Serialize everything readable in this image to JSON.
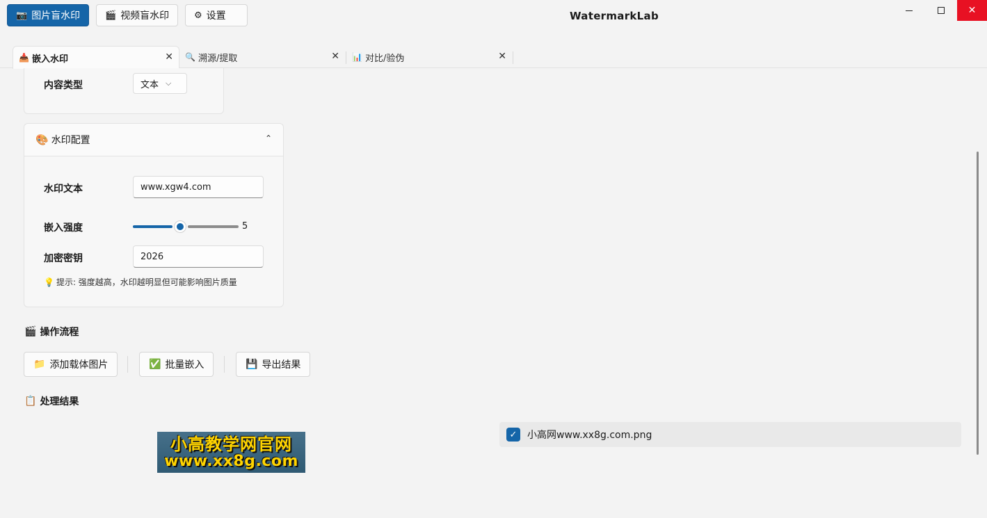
{
  "app": {
    "title": "WatermarkLab"
  },
  "toolbar": {
    "image_btn": {
      "icon": "📷",
      "label": "图片盲水印"
    },
    "video_btn": {
      "icon": "🎬",
      "label": "视频盲水印"
    },
    "settings_btn": {
      "icon": "⚙",
      "label": "设置"
    }
  },
  "window_controls": {
    "minimize_icon": "minimize-icon",
    "maximize_icon": "maximize-icon",
    "close": "✕"
  },
  "tabs": [
    {
      "icon": "📥",
      "label": "嵌入水印",
      "close": "✕"
    },
    {
      "icon": "🔍",
      "label": "溯源/提取",
      "close": "✕"
    },
    {
      "icon": "📊",
      "label": "对比/验伪",
      "close": "✕"
    }
  ],
  "content_type": {
    "label": "内容类型",
    "value": "文本",
    "chevron": "⌵"
  },
  "watermark_config": {
    "icon": "🎨",
    "title": "水印配置",
    "chevron": "⌃",
    "text_label": "水印文本",
    "text_value": "www.xgw4.com",
    "strength_label": "嵌入强度",
    "strength_value": "5",
    "strength_fraction": 0.45,
    "key_label": "加密密钥",
    "key_value": "2026",
    "hint_icon": "💡",
    "hint": "提示: 强度越高，水印越明显但可能影响图片质量"
  },
  "workflow": {
    "icon": "🎬",
    "title": "操作流程",
    "buttons": [
      {
        "icon": "📁",
        "label": "添加载体图片"
      },
      {
        "icon": "✅",
        "label": "批量嵌入"
      },
      {
        "icon": "💾",
        "label": "导出结果"
      }
    ]
  },
  "results": {
    "icon": "📋",
    "title": "处理结果",
    "preview_text_line1": "小高教学网官网",
    "preview_text_line2": "www.xx8g.com",
    "items": [
      {
        "checked": true,
        "check": "✓",
        "filename": "小高网www.xx8g.com.png"
      }
    ]
  },
  "colors": {
    "accent": "#1565a8",
    "close_red": "#e81123",
    "logo_yellow": "#ffd400"
  }
}
